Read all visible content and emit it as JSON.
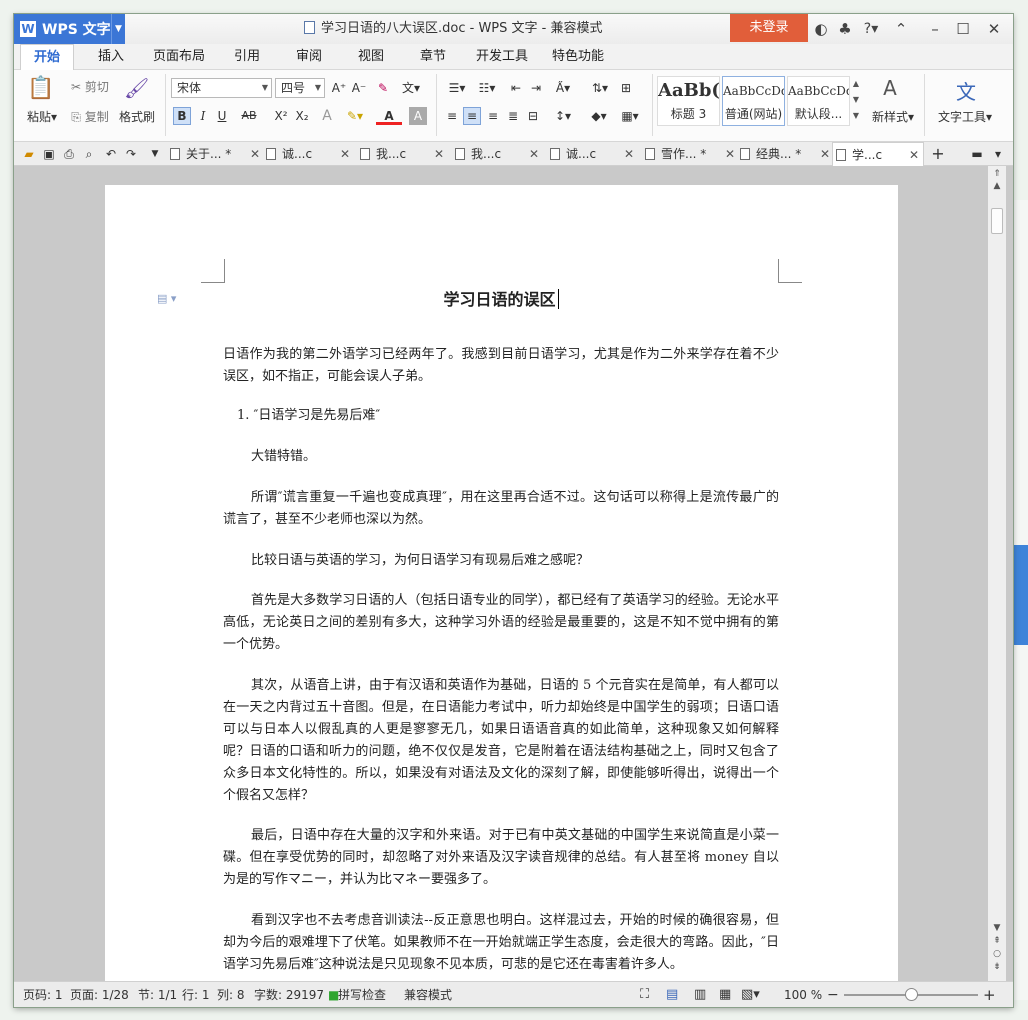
{
  "window": {
    "app_name": "WPS 文字",
    "title": "学习日语的八大误区.doc - WPS 文字 - 兼容模式",
    "login_label": "未登录",
    "help_label": "?"
  },
  "menu": [
    "开始",
    "插入",
    "页面布局",
    "引用",
    "审阅",
    "视图",
    "章节",
    "开发工具",
    "特色功能"
  ],
  "ribbon": {
    "paste": "粘贴",
    "cut": "剪切",
    "copy": "复制",
    "format_painter": "格式刷",
    "font_name": "宋体",
    "font_size": "四号",
    "bold": "B",
    "italic": "I",
    "underline": "U",
    "strike": "AB",
    "superscript": "X²",
    "subscript": "X₂",
    "styles": [
      {
        "preview": "AaBb(",
        "name": "标题 3"
      },
      {
        "preview": "AaBbCcDd",
        "name": "普通(网站)"
      },
      {
        "preview": "AaBbCcDd",
        "name": "默认段..."
      }
    ],
    "new_style": "新样式",
    "text_tools": "文字工具"
  },
  "tabs": [
    {
      "label": "关于...",
      "dirty": "*"
    },
    {
      "label": "诚...c",
      "dirty": ""
    },
    {
      "label": "我...c",
      "dirty": ""
    },
    {
      "label": "我...c",
      "dirty": ""
    },
    {
      "label": "诚...c",
      "dirty": ""
    },
    {
      "label": "雪作...",
      "dirty": "*"
    },
    {
      "label": "经典...",
      "dirty": "*"
    },
    {
      "label": "学...c",
      "dirty": ""
    }
  ],
  "document": {
    "title": "学习日语的误区",
    "paragraphs": [
      "日语作为我的第二外语学习已经两年了。我感到目前日语学习，尤其是作为二外来学存在着不少误区，如不指正，可能会误人子弟。",
      "1. ″日语学习是先易后难″",
      "大错特错。",
      "所谓″谎言重复一千遍也变成真理″，用在这里再合适不过。这句话可以称得上是流传最广的谎言了，甚至不少老师也深以为然。",
      "比较日语与英语的学习，为何日语学习有现易后难之感呢？",
      "首先是大多数学习日语的人（包括日语专业的同学），都已经有了英语学习的经验。无论水平高低，无论英日之间的差别有多大，这种学习外语的经验是最重要的，这是不知不觉中拥有的第一个优势。",
      "其次，从语音上讲，由于有汉语和英语作为基础，日语的 5 个元音实在是简单，有人都可以在一天之内背过五十音图。但是，在日语能力考试中，听力却始终是中国学生的弱项；日语口语可以与日本人以假乱真的人更是寥寥无几，如果日语语音真的如此简单，这种现象又如何解释呢？日语的口语和听力的问题，绝不仅仅是发音，它是附着在语法结构基础之上，同时又包含了众多日本文化特性的。所以，如果没有对语法及文化的深刻了解，即使能够听得出，说得出一个个假名又怎样？",
      "最后，日语中存在大量的汉字和外来语。对于已有中英文基础的中国学生来说简直是小菜一碟。但在享受优势的同时，却忽略了对外来语及汉字读音规律的总结。有人甚至将 money 自以为是的写作マニー，并认为比マネー要强多了。",
      "看到汉字也不去考虑音训读法--反正意思也明白。这样混过去，开始的时候的确很容易，但却为今后的艰难埋下了伏笔。如果教师不在一开始就端正学生态度，会走很大的弯路。因此，″日语学习先易后难″这种说法是只见现象不见本质，可悲的是它还在毒害着许多人。"
    ]
  },
  "status": {
    "page": "页码: 1",
    "pages": "页面: 1/28",
    "section": "节: 1/1",
    "row": "行: 1",
    "col": "列: 8",
    "words": "字数: 29197",
    "spell": "拼写检查",
    "compat": "兼容模式",
    "zoom": "100 %",
    "zoom_fraction": 0.5
  }
}
